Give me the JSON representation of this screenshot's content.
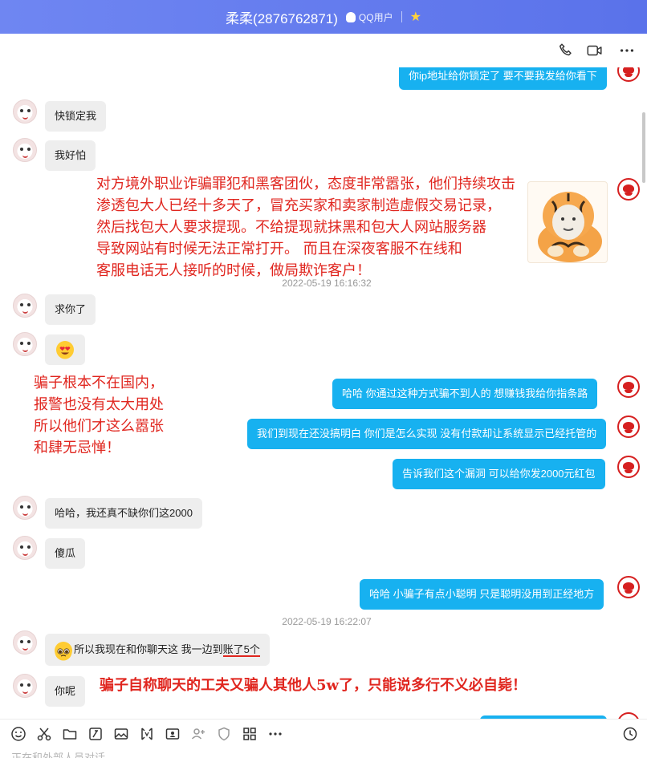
{
  "window": {
    "title": "柔柔(2876762871)",
    "user_type": "QQ用户"
  },
  "messages": {
    "m0": "你ip地址给你锁定了 要不要我发给你看下",
    "m1": "快锁定我",
    "m2": "我好怕",
    "ts1": "2022-05-19 16:16:32",
    "m3": "求你了",
    "m5": "哈哈  你通过这种方式骗不到人的   想赚钱我给你指条路",
    "m6": "我们到现在还没搞明白 你们是怎么实现 没有付款却让系统显示已经托管的",
    "m7": "告诉我们这个漏洞 可以给你发2000元红包",
    "m8": "哈哈，我还真不缺你们这2000",
    "m9": "傻瓜",
    "m10": "哈哈  小骗子有点小聪明 只是聪明没用到正经地方",
    "ts2": "2022-05-19 16:22:07",
    "m11_a": "所以我现在和你聊天这 我一边到",
    "m11_b": "账了5个",
    "m12": "你呢"
  },
  "annotations": {
    "a1": [
      "对方境外职业诈骗罪犯和黑客团伙，态度非常嚣张，他们持续攻击",
      "渗透包大人已经十多天了，冒充买家和卖家制造虚假交易记录，",
      "然后找包大人要求提现。不给提现就抹黑和包大人网站服务器",
      "导致网站有时候无法正常打开。 而且在深夜客服不在线和",
      "客服电话无人接听的时候，做局欺诈客户！"
    ],
    "a2": [
      "骗子根本不在国内，",
      "报警也没有太大用处",
      "所以他们才这么嚣张",
      "和肆无忌惮！"
    ],
    "a3": "骗子自称聊天的工夫又骗人其他人5w了，只能说多行不义必自毙！"
  },
  "input": {
    "typing_status": "正在和外部人员对话"
  },
  "colors": {
    "titlebar": "#5a72ea",
    "outgoing_bubble": "#17b1f0",
    "incoming_bubble": "#eeeeee",
    "annotation_red": "#e0261f"
  }
}
